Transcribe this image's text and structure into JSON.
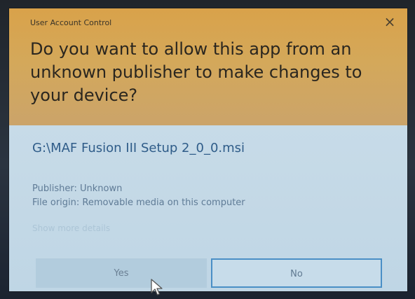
{
  "window": {
    "title": "User Account Control",
    "close_glyph": "×"
  },
  "prompt": {
    "question": "Do you want to allow this app from an unknown publisher to make changes to your device?"
  },
  "app": {
    "filename": "G:\\MAF Fusion III Setup 2_0_0.msi",
    "publisher": "Publisher: Unknown",
    "file_origin": "File origin: Removable media on this computer",
    "show_more_details": "Show more details"
  },
  "buttons": {
    "yes": "Yes",
    "no": "No"
  },
  "colors": {
    "header_bg": "#d4a85a",
    "body_bg": "#c6dae7",
    "link_color": "#2f5c89",
    "focus_border": "#4a8fc6"
  },
  "icons": {
    "close": "close-icon",
    "cursor": "mouse-pointer-icon"
  }
}
